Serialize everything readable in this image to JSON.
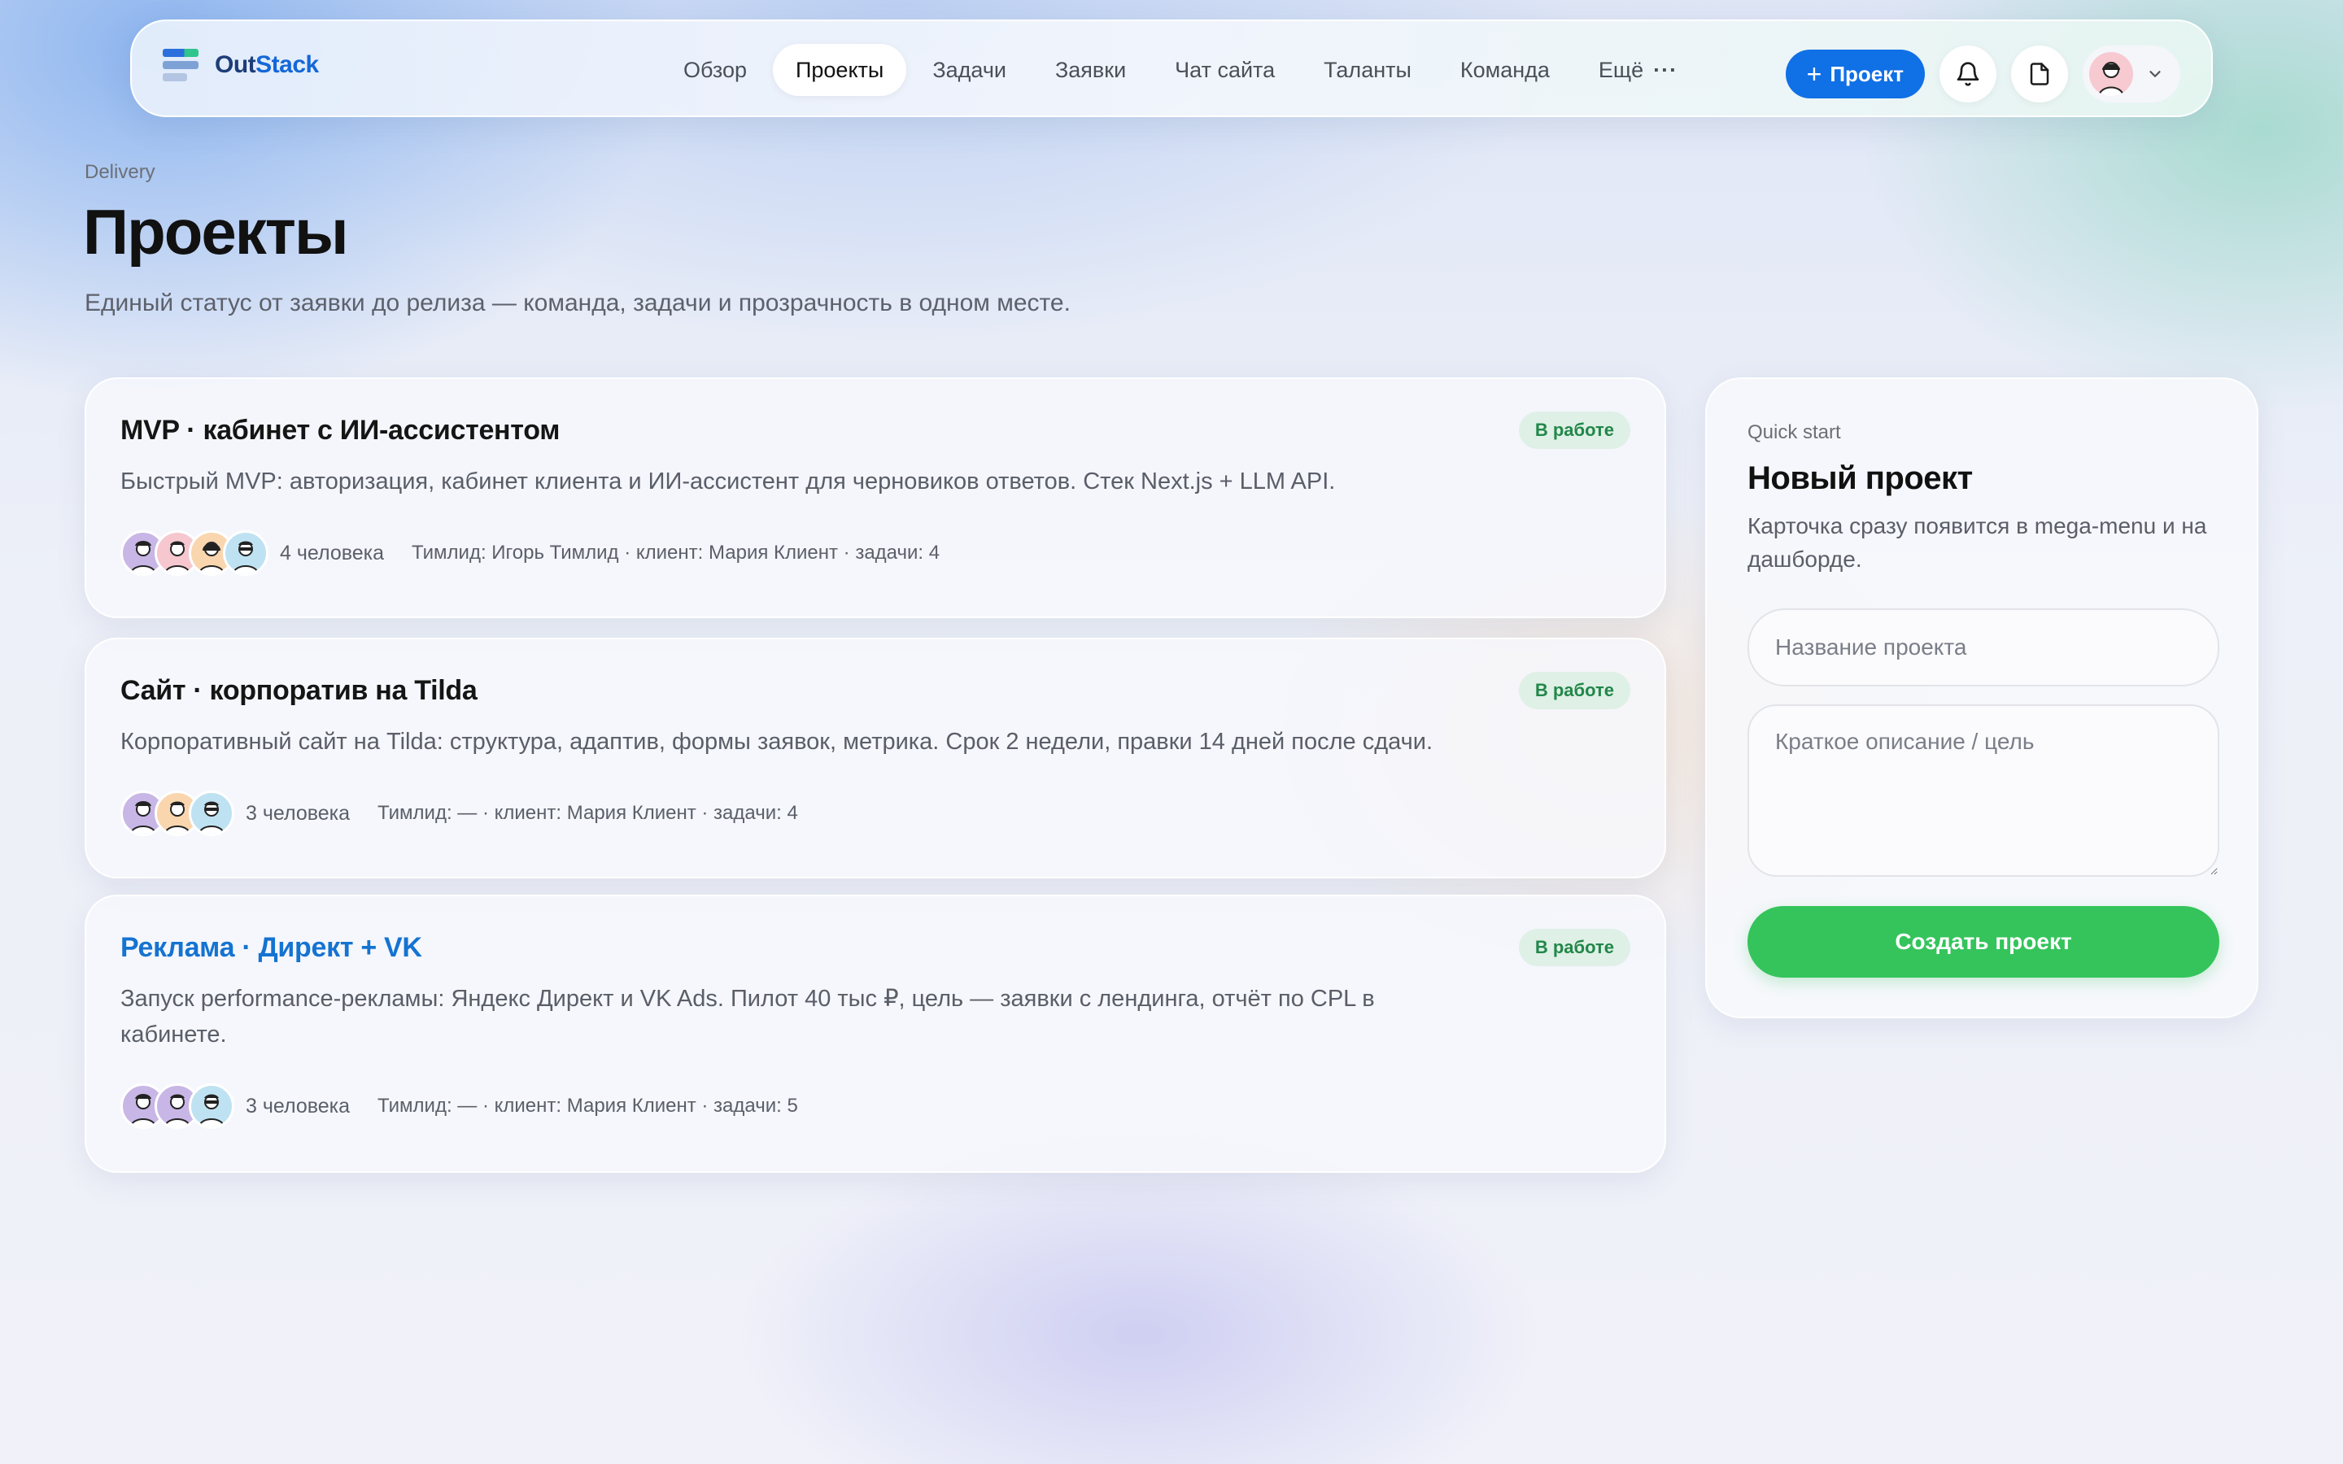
{
  "brand": {
    "name_prefix": "Out",
    "name_suffix": "Stack"
  },
  "nav": {
    "items": [
      {
        "label": "Обзор",
        "active": false
      },
      {
        "label": "Проекты",
        "active": true
      },
      {
        "label": "Задачи",
        "active": false
      },
      {
        "label": "Заявки",
        "active": false
      },
      {
        "label": "Чат сайта",
        "active": false
      },
      {
        "label": "Таланты",
        "active": false
      },
      {
        "label": "Команда",
        "active": false
      },
      {
        "label": "Ещё",
        "active": false
      }
    ],
    "more_dots": "···"
  },
  "actions": {
    "new_project_plus": "+",
    "new_project_label": "Проект",
    "notifications_icon": "bell-icon",
    "documents_icon": "document-icon",
    "user_menu_icon": "chevron-down-icon"
  },
  "header": {
    "kicker": "Delivery",
    "title": "Проекты",
    "subtitle": "Единый статус от заявки до релиза — команда, задачи и прозрачность в одном месте."
  },
  "projects": [
    {
      "title": "MVP · кабинет с ИИ-ассистентом",
      "status": "В работе",
      "description": "Быстрый MVP: авторизация, кабинет клиента и ИИ-ассистент для черновиков ответов. Стек Next.js + LLM API.",
      "people": "4 человека",
      "meta": "Тимлид: Игорь Тимлид · клиент: Мария Клиент · задачи: 4",
      "highlighted": false
    },
    {
      "title": "Сайт · корпоратив на Tilda",
      "status": "В работе",
      "description": "Корпоративный сайт на Tilda: структура, адаптив, формы заявок, метрика. Срок 2 недели, правки 14 дней после сдачи.",
      "people": "3 человека",
      "meta": "Тимлид: — · клиент: Мария Клиент · задачи: 4",
      "highlighted": false
    },
    {
      "title": "Реклама · Директ + VK",
      "status": "В работе",
      "description": "Запуск performance-рекламы: Яндекс Директ и VK Ads. Пилот 40 тыс ₽, цель — заявки с лендинга, отчёт по CPL в кабинете.",
      "people": "3 человека",
      "meta": "Тимлид: — · клиент: Мария Клиент · задачи: 5",
      "highlighted": true
    }
  ],
  "quick_start": {
    "kicker": "Quick start",
    "title": "Новый проект",
    "description": "Карточка сразу появится в mega-menu и на дашборде.",
    "name_placeholder": "Название проекта",
    "name_value": "",
    "description_placeholder": "Краткое описание / цель",
    "description_value": "",
    "submit_label": "Создать проект"
  },
  "colors": {
    "accent_blue": "#1070e6",
    "status_green_bg": "#dff0e6",
    "status_green_text": "#22874a",
    "create_button": "#34c45b",
    "link_title": "#1573d1"
  }
}
